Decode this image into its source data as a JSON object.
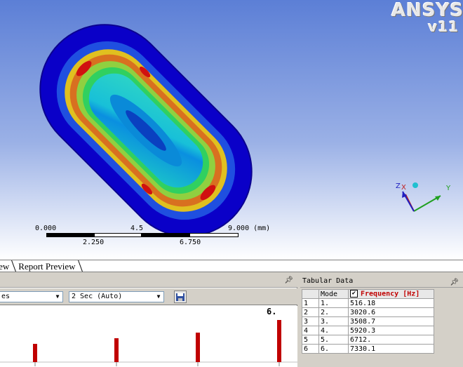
{
  "logo": {
    "line1": "ANSYS",
    "line2": "v11"
  },
  "scale": {
    "top_labels": [
      "0.000",
      "4.5",
      "9.000 (mm)"
    ],
    "bottom_labels": [
      "2.250",
      "6.750"
    ]
  },
  "triad": {
    "x": "X",
    "y": "Y",
    "z": "Z"
  },
  "tabs": [
    "view",
    "Report Preview"
  ],
  "graph": {
    "dropdown_left": "es",
    "dropdown_time": "2 Sec (Auto)",
    "top_label": "6.",
    "bars": [
      {
        "mode": 1,
        "frequency": 516.18
      },
      {
        "mode": 2,
        "frequency": 3020.6
      },
      {
        "mode": 3,
        "frequency": 3508.7
      },
      {
        "mode": 4,
        "frequency": 5920.3
      },
      {
        "mode": 5,
        "frequency": 6712
      },
      {
        "mode": 6,
        "frequency": 7330.1
      }
    ]
  },
  "tabular": {
    "title": "Tabular Data",
    "headers": {
      "mode": "Mode",
      "frequency": "Frequency [Hz]"
    },
    "rows": [
      {
        "idx": "1",
        "mode": "1.",
        "frequency": "516.18"
      },
      {
        "idx": "2",
        "mode": "2.",
        "frequency": "3020.6"
      },
      {
        "idx": "3",
        "mode": "3.",
        "frequency": "3508.7"
      },
      {
        "idx": "4",
        "mode": "4.",
        "frequency": "5920.3"
      },
      {
        "idx": "5",
        "mode": "5.",
        "frequency": "6712."
      },
      {
        "idx": "6",
        "mode": "6.",
        "frequency": "7330.1"
      }
    ]
  },
  "colors": {
    "bar": "#c00000",
    "frequency_header": "#c00000",
    "accent_blue": "#0a00c8"
  }
}
